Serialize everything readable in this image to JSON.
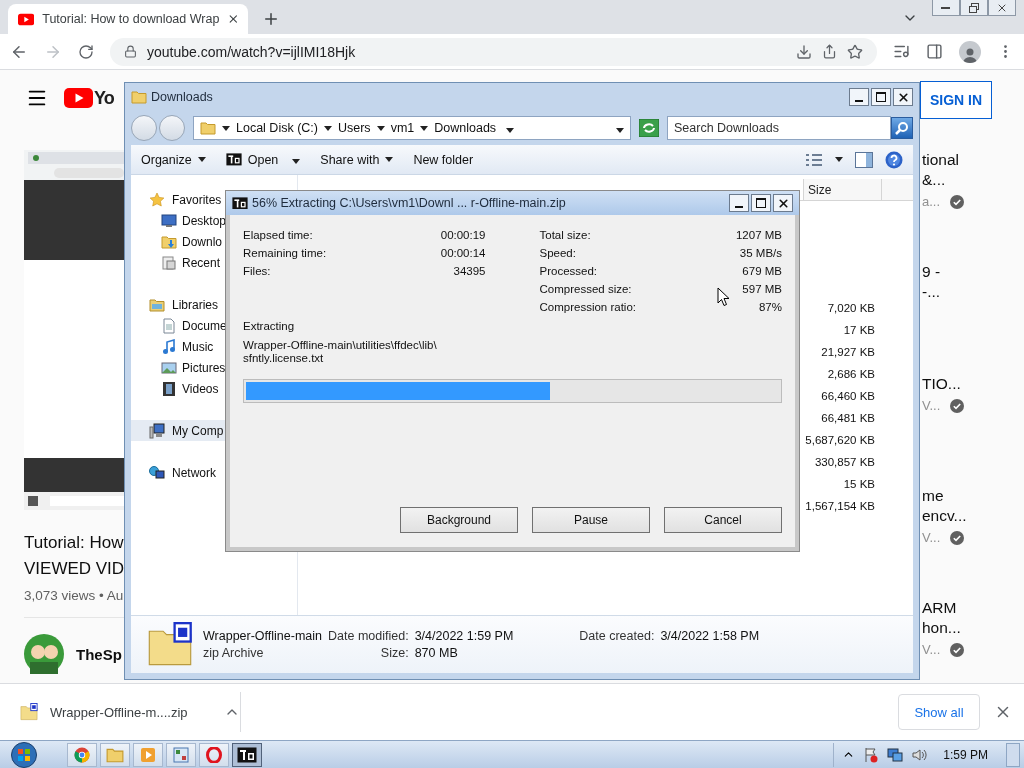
{
  "browser": {
    "tabs": [
      {
        "title": "Tutorial: How to download Wrap",
        "selected": true
      }
    ],
    "url": "youtube.com/watch?v=ijlIMI18Hjk"
  },
  "youtube": {
    "logo_text": "Yo",
    "sign_in": "SIGN IN",
    "video": {
      "title_lines": [
        "Tutorial: How",
        "VIEWED VID"
      ],
      "meta": "3,073 views • Au",
      "channel": "TheSp"
    },
    "recommendations": [
      {
        "title_lines": [
          "tional",
          "&..."
        ],
        "channel": "a...",
        "verified": true
      },
      {
        "title_lines": [
          "9 -",
          "-..."
        ],
        "verified": false
      },
      {
        "title_lines": [
          "TIO..."
        ],
        "channel": "V...",
        "verified": true
      },
      {
        "title_lines": [
          "me",
          "encv..."
        ],
        "channel": "V...",
        "verified": true
      },
      {
        "title_lines": [
          "ARM",
          "hon..."
        ],
        "channel": "V...",
        "verified": true
      }
    ]
  },
  "explorer": {
    "title": "Downloads",
    "breadcrumb": [
      "Local Disk (C:)",
      "Users",
      "vm1",
      "Downloads"
    ],
    "search_placeholder": "Search Downloads",
    "toolbar": [
      {
        "label": "Organize",
        "kind": "menu"
      },
      {
        "label": "Open",
        "kind": "app-menu"
      },
      {
        "label": "Share with",
        "kind": "menu"
      },
      {
        "label": "New folder",
        "kind": "plain"
      }
    ],
    "nav": [
      {
        "label": "Favorites",
        "kind": "favorites",
        "selected": false,
        "children": [
          {
            "label": "Desktop",
            "kind": "desktop",
            "selected": false
          },
          {
            "label": "Downlo",
            "kind": "downloads",
            "selected": false
          },
          {
            "label": "Recent",
            "kind": "recent",
            "selected": false
          }
        ]
      },
      {
        "label": "Libraries",
        "kind": "libraries",
        "selected": false,
        "children": [
          {
            "label": "Docume",
            "kind": "documents",
            "selected": false
          },
          {
            "label": "Music",
            "kind": "music",
            "selected": false
          },
          {
            "label": "Pictures",
            "kind": "pictures",
            "selected": false
          },
          {
            "label": "Videos",
            "kind": "videos",
            "selected": false
          }
        ]
      },
      {
        "label": "My Comp",
        "kind": "computer",
        "selected": true
      },
      {
        "label": "Network",
        "kind": "network",
        "selected": false
      }
    ],
    "size_column": {
      "header": "Size",
      "values": [
        "7,020 KB",
        "17 KB",
        "21,927 KB",
        "2,686 KB",
        "66,460 KB",
        "66,481 KB",
        "5,687,620 KB",
        "330,857 KB",
        "15 KB",
        "1,567,154 KB"
      ]
    },
    "details": {
      "name": "Wrapper-Offline-main",
      "type": "zip Archive",
      "fields": [
        {
          "label": "Date modified:",
          "value": "3/4/2022 1:59 PM"
        },
        {
          "label": "Size:",
          "value": "870 MB"
        },
        {
          "label": "Date created:",
          "value": "3/4/2022 1:58 PM"
        }
      ]
    }
  },
  "extract_dialog": {
    "title": "56% Extracting C:\\Users\\vm1\\Downl ... r-Offline-main.zip",
    "left_stats": [
      {
        "label": "Elapsed time:",
        "value": "00:00:19"
      },
      {
        "label": "Remaining time:",
        "value": "00:00:14"
      },
      {
        "label": "Files:",
        "value": "34395"
      }
    ],
    "right_stats": [
      {
        "label": "Total size:",
        "value": "1207 MB"
      },
      {
        "label": "Speed:",
        "value": "35 MB/s"
      },
      {
        "label": "Processed:",
        "value": "679 MB"
      },
      {
        "label": "Compressed size:",
        "value": "597 MB"
      },
      {
        "label": "Compression ratio:",
        "value": "87%"
      }
    ],
    "status": "Extracting",
    "path_lines": [
      "Wrapper-Offline-main\\utilities\\ffdec\\lib\\",
      "sfntly.license.txt"
    ],
    "progress": {
      "level": 0.57
    },
    "buttons": [
      "Background",
      "Pause",
      "Cancel"
    ]
  },
  "download_bar": {
    "file": "Wrapper-Offline-m....zip",
    "show_all": "Show all"
  },
  "taskbar": {
    "apps": [
      {
        "kind": "chrome",
        "selected": false
      },
      {
        "kind": "folder",
        "selected": false
      },
      {
        "kind": "media",
        "selected": false
      },
      {
        "kind": "control",
        "selected": false
      },
      {
        "kind": "opera",
        "selected": false
      },
      {
        "kind": "archiver",
        "selected": true
      }
    ],
    "clock": "1:59 PM"
  }
}
